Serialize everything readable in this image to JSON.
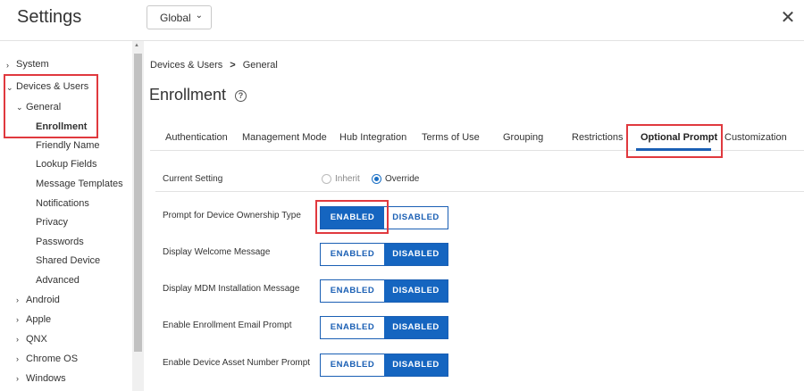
{
  "header": {
    "title": "Settings",
    "scope": "Global",
    "close_glyph": "✕"
  },
  "sidebar": {
    "items": [
      {
        "label": "System"
      },
      {
        "label": "Devices & Users"
      },
      {
        "label": "General"
      },
      {
        "label": "Enrollment"
      },
      {
        "label": "Friendly Name"
      },
      {
        "label": "Lookup Fields"
      },
      {
        "label": "Message Templates"
      },
      {
        "label": "Notifications"
      },
      {
        "label": "Privacy"
      },
      {
        "label": "Passwords"
      },
      {
        "label": "Shared Device"
      },
      {
        "label": "Advanced"
      },
      {
        "label": "Android"
      },
      {
        "label": "Apple"
      },
      {
        "label": "QNX"
      },
      {
        "label": "Chrome OS"
      },
      {
        "label": "Windows"
      }
    ]
  },
  "breadcrumb": {
    "parent": "Devices & Users",
    "sep": ">",
    "current": "General"
  },
  "page": {
    "title": "Enrollment",
    "help_glyph": "?"
  },
  "tabs": [
    {
      "label": "Authentication"
    },
    {
      "label": "Management Mode"
    },
    {
      "label": "Hub Integration"
    },
    {
      "label": "Terms of Use"
    },
    {
      "label": "Grouping"
    },
    {
      "label": "Restrictions"
    },
    {
      "label": "Optional Prompt"
    },
    {
      "label": "Customization"
    }
  ],
  "current_setting": {
    "label": "Current Setting",
    "inherit": "Inherit",
    "override": "Override",
    "selected": "Override"
  },
  "toggle_labels": {
    "enabled": "ENABLED",
    "disabled": "DISABLED"
  },
  "settings": [
    {
      "label": "Prompt for Device Ownership Type",
      "value": "ENABLED"
    },
    {
      "label": "Display Welcome Message",
      "value": "DISABLED"
    },
    {
      "label": "Display MDM Installation Message",
      "value": "DISABLED"
    },
    {
      "label": "Enable Enrollment Email Prompt",
      "value": "DISABLED"
    },
    {
      "label": "Enable Device Asset Number Prompt",
      "value": "DISABLED"
    }
  ],
  "colors": {
    "accent": "#1565c0",
    "highlight": "#e0393e"
  }
}
